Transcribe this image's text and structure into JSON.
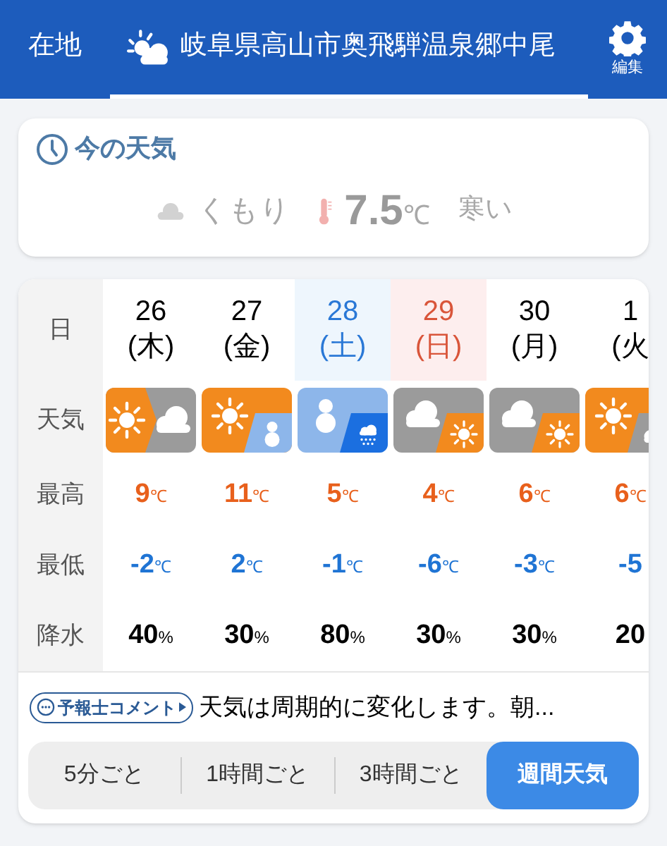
{
  "header": {
    "tabs": [
      {
        "label": "在地",
        "selected": false,
        "icon": false
      },
      {
        "label": "岐阜県高山市奥飛騨温泉郷中尾",
        "selected": true,
        "icon": true
      }
    ],
    "edit_label": "編集"
  },
  "now": {
    "title": "今の天気",
    "condition": "くもり",
    "temp": "7.5",
    "temp_unit": "℃",
    "feeling": "寒い"
  },
  "forecast": {
    "row_labels": [
      "日",
      "天気",
      "最高",
      "最低",
      "降水"
    ],
    "days": [
      {
        "date": "26",
        "dow": "(木)",
        "kind": "weekday",
        "weather": {
          "kind": "later",
          "parts": [
            {
              "kind": "sun"
            },
            {
              "kind": "cloud"
            }
          ]
        },
        "high": "9℃",
        "low": "-2℃",
        "precip": "40%"
      },
      {
        "date": "27",
        "dow": "(金)",
        "kind": "weekday",
        "weather": {
          "kind": "sometimes",
          "parts": [
            {
              "kind": "sun"
            },
            {
              "kind": "snow"
            }
          ]
        },
        "high": "11℃",
        "low": "2℃",
        "precip": "30%"
      },
      {
        "date": "28",
        "dow": "(土)",
        "kind": "saturday",
        "weather": {
          "kind": "sometimes",
          "parts": [
            {
              "kind": "snow"
            },
            {
              "kind": "rainsnow"
            }
          ]
        },
        "high": "5℃",
        "low": "-1℃",
        "precip": "80%"
      },
      {
        "date": "29",
        "dow": "(日)",
        "kind": "sunday",
        "weather": {
          "kind": "sometimes",
          "parts": [
            {
              "kind": "cloud"
            },
            {
              "kind": "sun"
            }
          ]
        },
        "high": "4℃",
        "low": "-6℃",
        "precip": "30%"
      },
      {
        "date": "30",
        "dow": "(月)",
        "kind": "weekday",
        "weather": {
          "kind": "sometimes",
          "parts": [
            {
              "kind": "cloud"
            },
            {
              "kind": "sun"
            }
          ]
        },
        "high": "6℃",
        "low": "-3℃",
        "precip": "30%"
      },
      {
        "date": "1",
        "dow": "(火",
        "kind": "weekday",
        "weather": {
          "kind": "sometimes",
          "parts": [
            {
              "kind": "sun"
            },
            {
              "kind": "cloud"
            }
          ]
        },
        "high": "6℃",
        "low": "-5",
        "precip": "20"
      }
    ],
    "comment_badge": "予報士コメント",
    "comment": "天気は周期的に変化します。朝..."
  },
  "modes": [
    {
      "label": "5分ごと",
      "selected": false
    },
    {
      "label": "1時間ごと",
      "selected": false
    },
    {
      "label": "3時間ごと",
      "selected": false
    },
    {
      "label": "週間天気",
      "selected": true
    }
  ]
}
